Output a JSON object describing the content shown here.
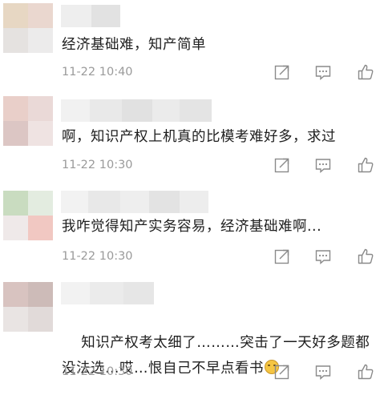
{
  "comments": [
    {
      "text": "经济基础难，知产简单",
      "time": "11-22 10:40",
      "avatar_colors": [
        "#e7d7c3",
        "#ead7cf",
        "#e5e2e0",
        "#ecebeb"
      ],
      "name_colors": [
        "#eeeeee",
        "#e2e2e2"
      ]
    },
    {
      "text": "啊，知识产权上机真的比模考难好多，求过",
      "time": "11-22 10:30",
      "avatar_colors": [
        "#e9cfc9",
        "#ead9d7",
        "#dcc6c4",
        "#efe3e2"
      ],
      "name_colors": [
        "#f1f1f1",
        "#e9e9e9",
        "#e1e1e1",
        "#ebebeb",
        "#e4e4e4"
      ]
    },
    {
      "text": "我咋觉得知产实务容易，经济基础难啊...",
      "time": "11-22 10:30",
      "avatar_colors": [
        "#c9dcc0",
        "#e3ece0",
        "#efe9e9",
        "#f1c8c2"
      ],
      "name_colors": [
        "#f2f2f2",
        "#e8e8e8",
        "#eeeeee",
        "#e3e3e3",
        "#ededed"
      ]
    },
    {
      "text": "知识产权考太细了………突击了一天好多题都没法选…哎…恨自己不早点看书",
      "time": "11-22 10:30",
      "avatar_colors": [
        "#d8c3c0",
        "#cdbbb8",
        "#e9e4e3",
        "#e1dad9"
      ],
      "name_colors": [
        "#f2f2f2",
        "#ebebeb",
        "#e6e6e6"
      ]
    }
  ],
  "icons": {
    "share": "share-icon",
    "reply": "comment-icon",
    "like": "thumbs-up-icon",
    "emoji": "laughing-tears-emoji-icon"
  }
}
